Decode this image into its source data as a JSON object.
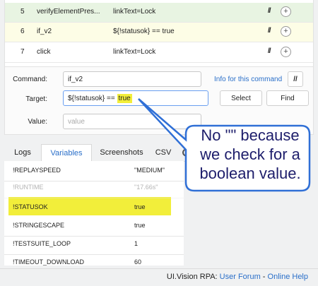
{
  "rows": [
    {
      "index": "5",
      "command": "verifyElementPres...",
      "target": "linkText=Lock",
      "comment": "//",
      "add": "+"
    },
    {
      "index": "6",
      "command": "if_v2",
      "target": "${!statusok} == true",
      "comment": "//",
      "add": "+"
    },
    {
      "index": "7",
      "command": "click",
      "target": "linkText=Lock",
      "comment": "//",
      "add": "+"
    }
  ],
  "editor": {
    "command_label": "Command",
    "command_value": "if_v2",
    "info_link": "Info for this command",
    "comment_toggle": "//",
    "target_label": "Target",
    "target_prefix": "${!statusok} == ",
    "target_highlight": "true",
    "select_button": "Select",
    "find_button": "Find",
    "value_label": "Value",
    "value_placeholder": "value"
  },
  "tabs": [
    "Logs",
    "Variables",
    "Screenshots",
    "CSV"
  ],
  "variables": [
    {
      "name": "!REPLAYSPEED",
      "value": "\"MEDIUM\""
    },
    {
      "name": "!RUNTIME",
      "value": "\"17.66s\""
    },
    {
      "name": "!STATUSOK",
      "value": "true"
    },
    {
      "name": "!STRINGESCAPE",
      "value": "true"
    },
    {
      "name": "!TESTSUITE_LOOP",
      "value": "1"
    },
    {
      "name": "!TIMEOUT_DOWNLOAD",
      "value": "60"
    }
  ],
  "callout": {
    "text": "No \"\" because we check for a boolean value."
  },
  "footer": {
    "prefix": "UI.Vision RPA: ",
    "forum_link": "User Forum",
    "separator": " - ",
    "help_link": "Online Help"
  },
  "colors": {
    "highlight": "#f2ee3a",
    "callout_border": "#2f6fd6",
    "link": "#2a6fc9",
    "callout_text": "#1d1d6b"
  }
}
